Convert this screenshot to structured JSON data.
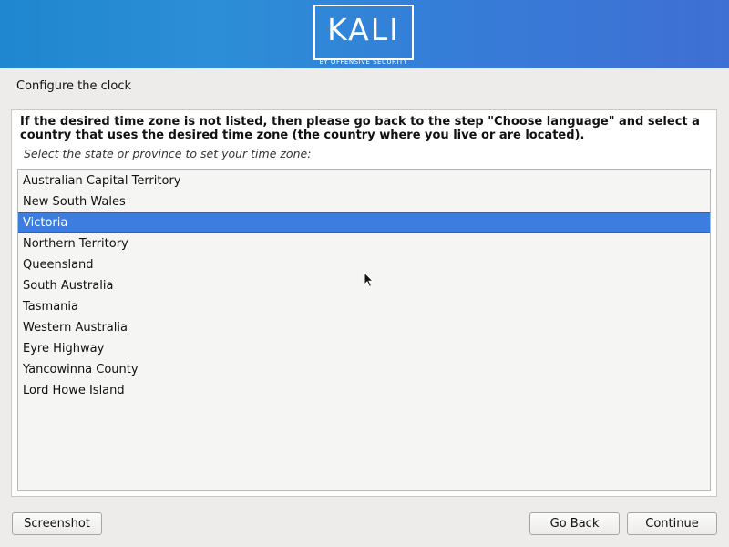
{
  "header": {
    "logo_text": "KALI",
    "logo_subtitle": "BY OFFENSIVE SECURITY"
  },
  "step_title": "Configure the clock",
  "description": "If the desired time zone is not listed, then please go back to the step \"Choose language\" and select a country that uses the desired time zone (the country where you live or are located).",
  "prompt": "Select the state or province to set your time zone:",
  "timezones": {
    "selected": "Victoria",
    "items": [
      "Australian Capital Territory",
      "New South Wales",
      "Victoria",
      "Northern Territory",
      "Queensland",
      "South Australia",
      "Tasmania",
      "Western Australia",
      "Eyre Highway",
      "Yancowinna County",
      "Lord Howe Island"
    ]
  },
  "buttons": {
    "screenshot": "Screenshot",
    "go_back": "Go Back",
    "continue": "Continue"
  },
  "colors": {
    "banner_start": "#1f87cf",
    "banner_end": "#3f6fd3",
    "selection": "#3d7de0"
  }
}
